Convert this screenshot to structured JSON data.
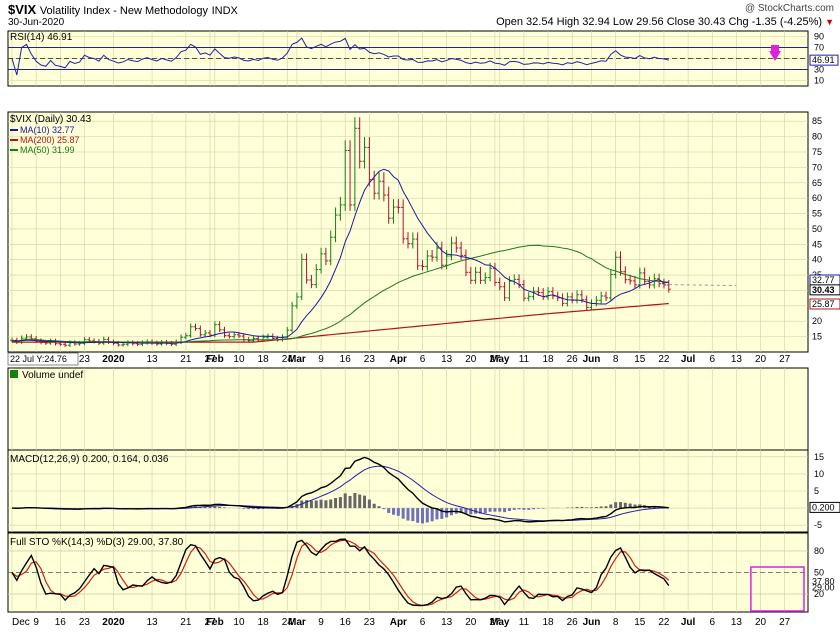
{
  "header": {
    "symbol": "$VIX",
    "name": "Volatility Index - New Methodology",
    "exchange": "INDX",
    "date": "30-Jun-2020",
    "watermark": "@ StockCharts.com",
    "ohlc": "Open 32.54  High 32.94  Low 29.56  Close 30.43  Chg -1.35 (-4.25%)",
    "chg_arrow": "▼"
  },
  "colors": {
    "bg": "#ffffd8",
    "grid": "#cfcfa8",
    "axis": "#000000",
    "up": "#108010",
    "down": "#b01030",
    "ma10": "#1a1aa0",
    "ma200": "#b01818",
    "ma50": "#1a7a1a",
    "rsi": "#2020b0",
    "rsi_fill": "#000040",
    "macd": "#000000",
    "signal": "#2020b0",
    "hist": "#666666",
    "stok": "#000000",
    "stod": "#d02010",
    "marker": "#e020e0"
  },
  "panels": {
    "rsi": {
      "label": "RSI(14) 46.91",
      "value_label": "46.91",
      "levels": [
        70,
        30
      ],
      "ticks": [
        "90",
        "70",
        "50",
        "30",
        "10"
      ]
    },
    "price": {
      "label": "$VIX (Daily) 30.43",
      "legend": [
        {
          "text": "MA(10) 32.77",
          "key": "ma10"
        },
        {
          "text": "MA(200) 25.87",
          "key": "ma200"
        },
        {
          "text": "MA(50) 31.99",
          "key": "ma50"
        }
      ],
      "last_labels": [
        "32.77",
        "30.43",
        "25.87"
      ],
      "ticks": [
        "85",
        "80",
        "75",
        "70",
        "65",
        "60",
        "55",
        "50",
        "45",
        "40",
        "35",
        "30",
        "25",
        "20",
        "15"
      ]
    },
    "volume": {
      "label": "Volume undef"
    },
    "macd": {
      "label": "MACD(12,26,9) 0.200, 0.164, 0.036",
      "value_label": "0.200",
      "ticks": [
        "15",
        "10",
        "5",
        "0",
        "-5"
      ]
    },
    "sto": {
      "label": "Full STO %K(14,3) %D(3) 29.00, 37.80",
      "value_labels": [
        "37.80",
        "29.00"
      ],
      "ticks": [
        "80",
        "50",
        "20"
      ]
    }
  },
  "xaxis": {
    "labels": [
      "Dec",
      "9",
      "16",
      "23",
      "2020",
      "13",
      "21",
      "27",
      "Feb",
      "10",
      "18",
      "24",
      "Mar",
      "9",
      "16",
      "23",
      "Apr",
      "6",
      "13",
      "20",
      "27",
      "May",
      "11",
      "18",
      "26",
      "Jun",
      "8",
      "15",
      "22",
      "Jul",
      "6",
      "13",
      "20",
      "27"
    ],
    "label_idx": [
      0,
      5,
      10,
      15,
      21,
      29,
      36,
      41,
      42,
      47,
      52,
      57,
      59,
      64,
      69,
      74,
      80,
      85,
      90,
      95,
      100,
      101,
      106,
      111,
      116,
      120,
      125,
      130,
      135,
      140,
      145,
      150,
      155,
      160
    ],
    "bold": [
      "2020",
      "Feb",
      "Mar",
      "Apr",
      "May",
      "Jun",
      "Jul"
    ],
    "cursor": "22 Jul Y:24.76"
  },
  "chart_data": {
    "type": "candlestick",
    "symbol": "$VIX",
    "period": "Daily",
    "last": {
      "open": 32.54,
      "high": 32.94,
      "low": 29.56,
      "close": 30.43,
      "chg": -1.35,
      "chg_pct": -4.25
    },
    "closes": [
      13.8,
      13.2,
      14.5,
      14.9,
      14.3,
      13.6,
      13.1,
      12.9,
      13.5,
      12.7,
      12.5,
      12.2,
      13.0,
      12.6,
      12.8,
      14.0,
      13.6,
      13.4,
      12.9,
      14.1,
      13.2,
      12.8,
      12.3,
      12.5,
      13.0,
      12.7,
      12.5,
      13.0,
      13.3,
      12.9,
      12.6,
      13.1,
      12.8,
      12.5,
      13.2,
      14.8,
      15.3,
      18.2,
      17.6,
      15.6,
      16.2,
      15.5,
      18.9,
      17.2,
      15.3,
      15.0,
      15.6,
      15.2,
      14.0,
      13.7,
      14.4,
      13.9,
      14.8,
      15.1,
      14.4,
      14.0,
      14.9,
      17.1,
      25.0,
      27.9,
      40.1,
      33.4,
      31.9,
      36.8,
      41.9,
      39.6,
      47.3,
      54.5,
      57.8,
      75.5,
      57.8,
      82.7,
      72.0,
      76.5,
      66.0,
      61.6,
      65.5,
      61.0,
      53.5,
      57.1,
      57.0,
      46.8,
      45.2,
      46.7,
      38.0,
      37.8,
      41.2,
      40.8,
      43.8,
      38.2,
      41.2,
      45.4,
      43.8,
      41.4,
      35.9,
      33.3,
      35.9,
      33.3,
      34.2,
      37.2,
      32.6,
      31.2,
      27.6,
      33.0,
      33.6,
      31.9,
      27.5,
      28.0,
      29.6,
      29.3,
      27.9,
      29.6,
      28.2,
      27.6,
      25.8,
      27.9,
      26.8,
      28.6,
      27.0,
      24.5,
      25.8,
      26.8,
      28.2,
      27.6,
      35.2,
      40.8,
      36.1,
      33.5,
      33.1,
      31.8,
      35.7,
      32.9,
      31.8,
      33.8,
      32.2,
      31.8,
      30.4
    ],
    "ma10": [
      13.6,
      13.6,
      13.7,
      13.8,
      13.8,
      13.7,
      13.6,
      13.5,
      13.5,
      13.4,
      13.3,
      13.2,
      13.1,
      13.1,
      13.0,
      13.0,
      13.1,
      13.1,
      13.2,
      13.2,
      13.2,
      13.1,
      13.1,
      13.1,
      13.0,
      13.0,
      13.0,
      12.9,
      12.9,
      12.9,
      12.9,
      12.9,
      12.9,
      12.8,
      12.9,
      13.1,
      13.4,
      13.9,
      14.3,
      14.6,
      14.9,
      15.1,
      15.6,
      16.0,
      16.3,
      16.5,
      16.5,
      16.2,
      15.9,
      15.6,
      15.3,
      15.1,
      15.1,
      15.1,
      15.0,
      14.8,
      14.7,
      14.9,
      16.0,
      17.4,
      19.8,
      21.8,
      23.5,
      25.5,
      27.7,
      30.2,
      33.2,
      36.9,
      40.7,
      45.8,
      49.3,
      54.2,
      58.6,
      62.6,
      65.0,
      66.9,
      68.7,
      69.4,
      68.8,
      67.0,
      65.8,
      62.2,
      59.5,
      56.5,
      53.5,
      51.1,
      48.7,
      46.7,
      44.8,
      42.9,
      41.8,
      41.6,
      41.5,
      41.0,
      40.8,
      40.4,
      39.9,
      39.2,
      38.3,
      38.2,
      37.3,
      35.9,
      34.3,
      33.4,
      32.9,
      31.9,
      30.4,
      29.8,
      29.3,
      28.5,
      28.0,
      28.3,
      28.6,
      28.0,
      27.4,
      27.0,
      26.9,
      26.9,
      26.7,
      26.2,
      25.8,
      25.7,
      25.6,
      25.6,
      26.6,
      27.9,
      28.8,
      29.3,
      29.8,
      30.6,
      31.6,
      32.0,
      32.4,
      33.1,
      33.5,
      32.4,
      32.8
    ]
  }
}
